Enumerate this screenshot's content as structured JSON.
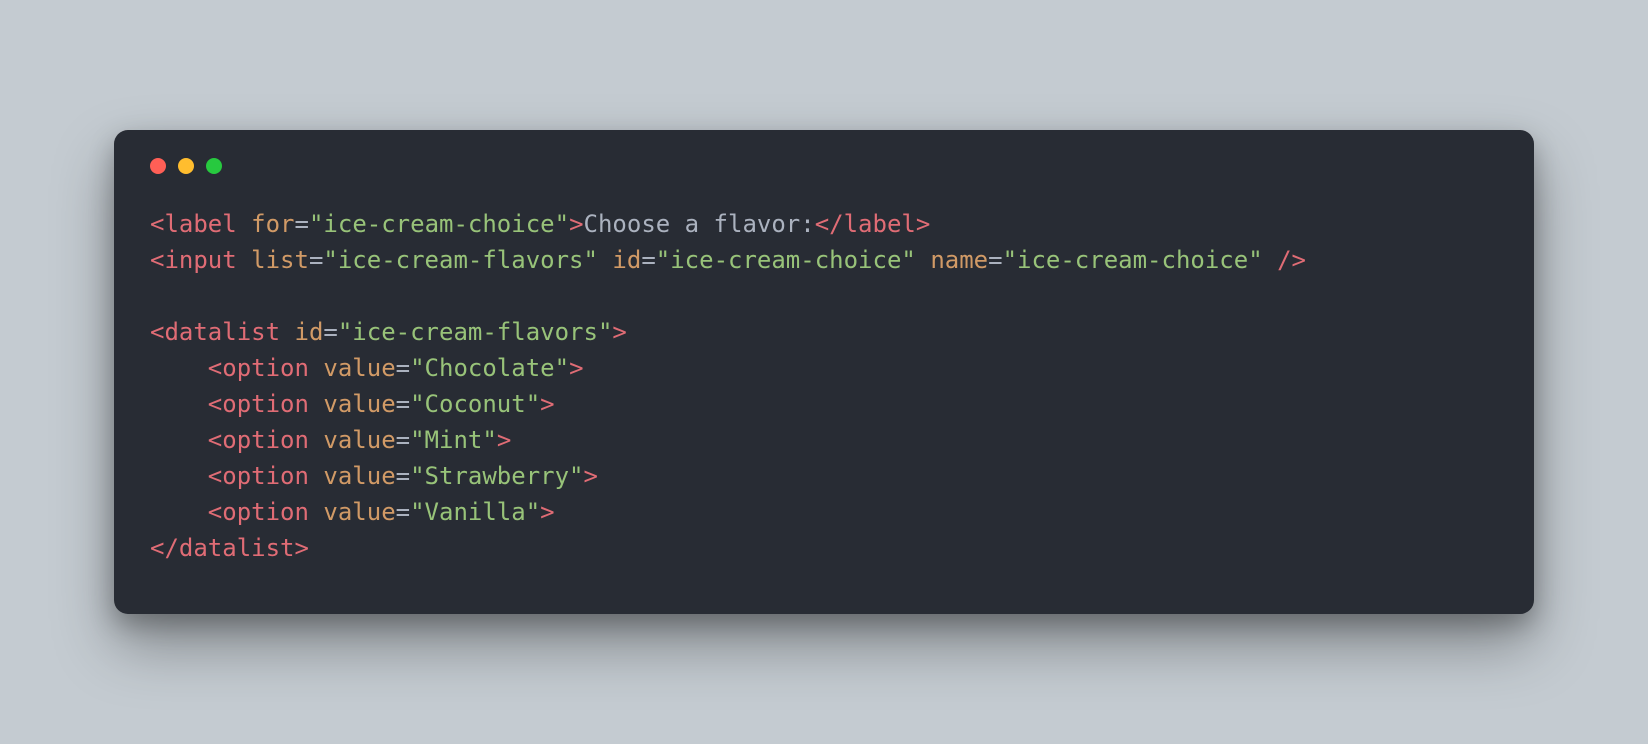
{
  "line1": {
    "open": "<label",
    "attr": "for",
    "eq": "=",
    "val": "\"ice-cream-choice\"",
    "close": ">",
    "text": "Choose a flavor:",
    "end": "</label>"
  },
  "line2": {
    "open": "<input",
    "a1": "list",
    "v1": "\"ice-cream-flavors\"",
    "a2": "id",
    "v2": "\"ice-cream-choice\"",
    "a3": "name",
    "v3": "\"ice-cream-choice\"",
    "close": "/>",
    "eq": "="
  },
  "line3": {
    "open": "<datalist",
    "attr": "id",
    "eq": "=",
    "val": "\"ice-cream-flavors\"",
    "close": ">"
  },
  "opt": {
    "open": "<option",
    "attr": "value",
    "eq": "=",
    "close": ">",
    "v1": "\"Chocolate\"",
    "v2": "\"Coconut\"",
    "v3": "\"Mint\"",
    "v4": "\"Strawberry\"",
    "v5": "\"Vanilla\""
  },
  "line9": {
    "end": "</datalist>"
  },
  "indent": "    "
}
